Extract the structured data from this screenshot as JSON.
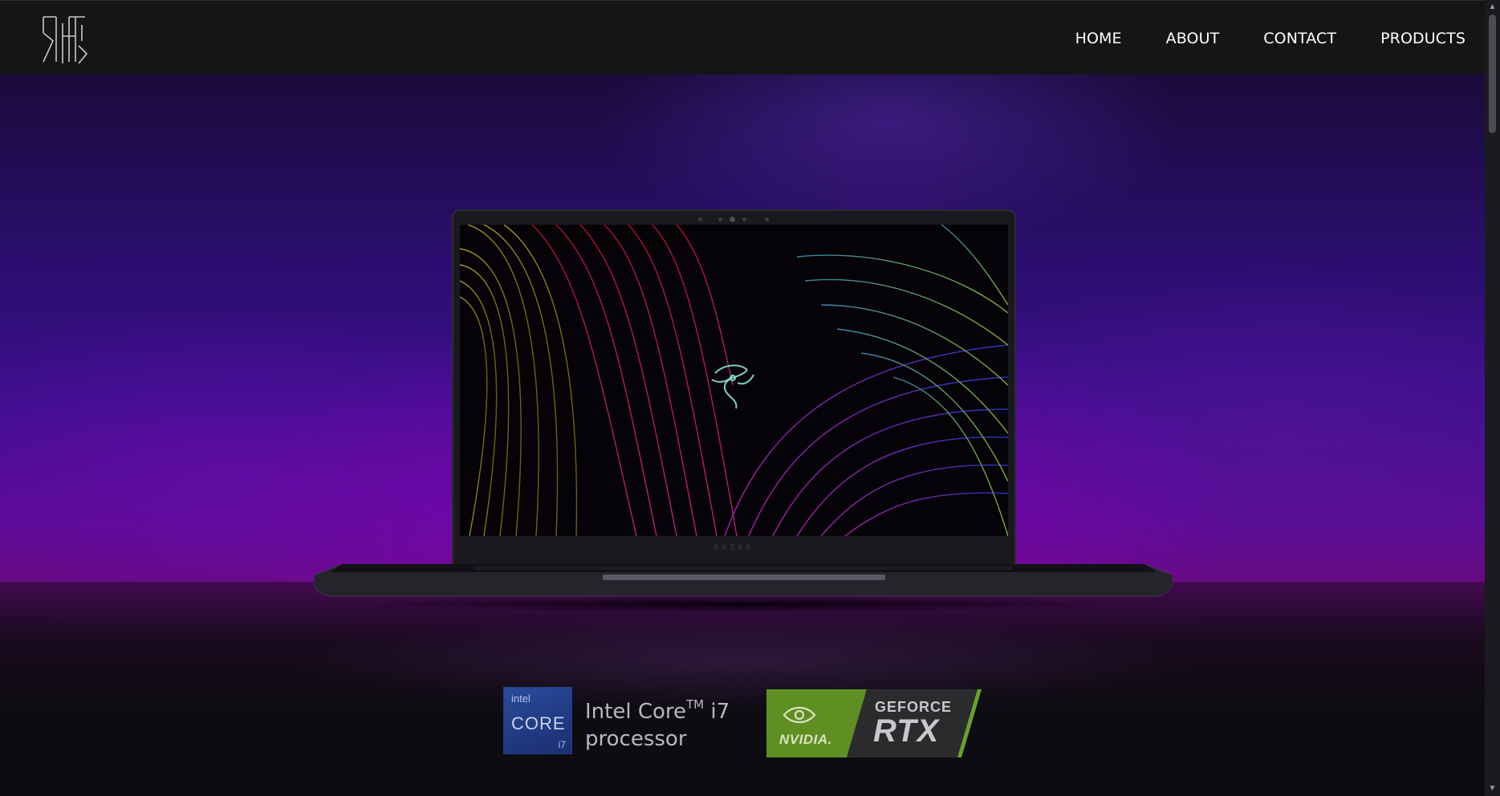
{
  "header": {
    "logo_icon": "monogram-logo-icon",
    "nav": [
      {
        "label": "HOME"
      },
      {
        "label": "ABOUT"
      },
      {
        "label": "CONTACT"
      },
      {
        "label": "PRODUCTS"
      }
    ]
  },
  "hero": {
    "laptop_brand": "RAZER",
    "screen_logo_icon": "razer-snake-icon",
    "badges": {
      "intel": {
        "logo_text": "intel",
        "brand": "CORE",
        "tier": "i7",
        "caption_line1": "Intel Core",
        "caption_tm": "TM",
        "caption_model": " i7",
        "caption_line2": "processor"
      },
      "nvidia": {
        "logo_text": "NVIDIA.",
        "line1": "GEFORCE",
        "line2": "RTX"
      }
    }
  },
  "colors": {
    "navbar_bg": "#151517",
    "hero_purple": "#5a0c93",
    "nvidia_green": "#76b900",
    "intel_blue": "#1b2f72"
  },
  "scrollbar": {
    "up_icon": "chevron-up-icon",
    "down_icon": "chevron-down-icon"
  }
}
